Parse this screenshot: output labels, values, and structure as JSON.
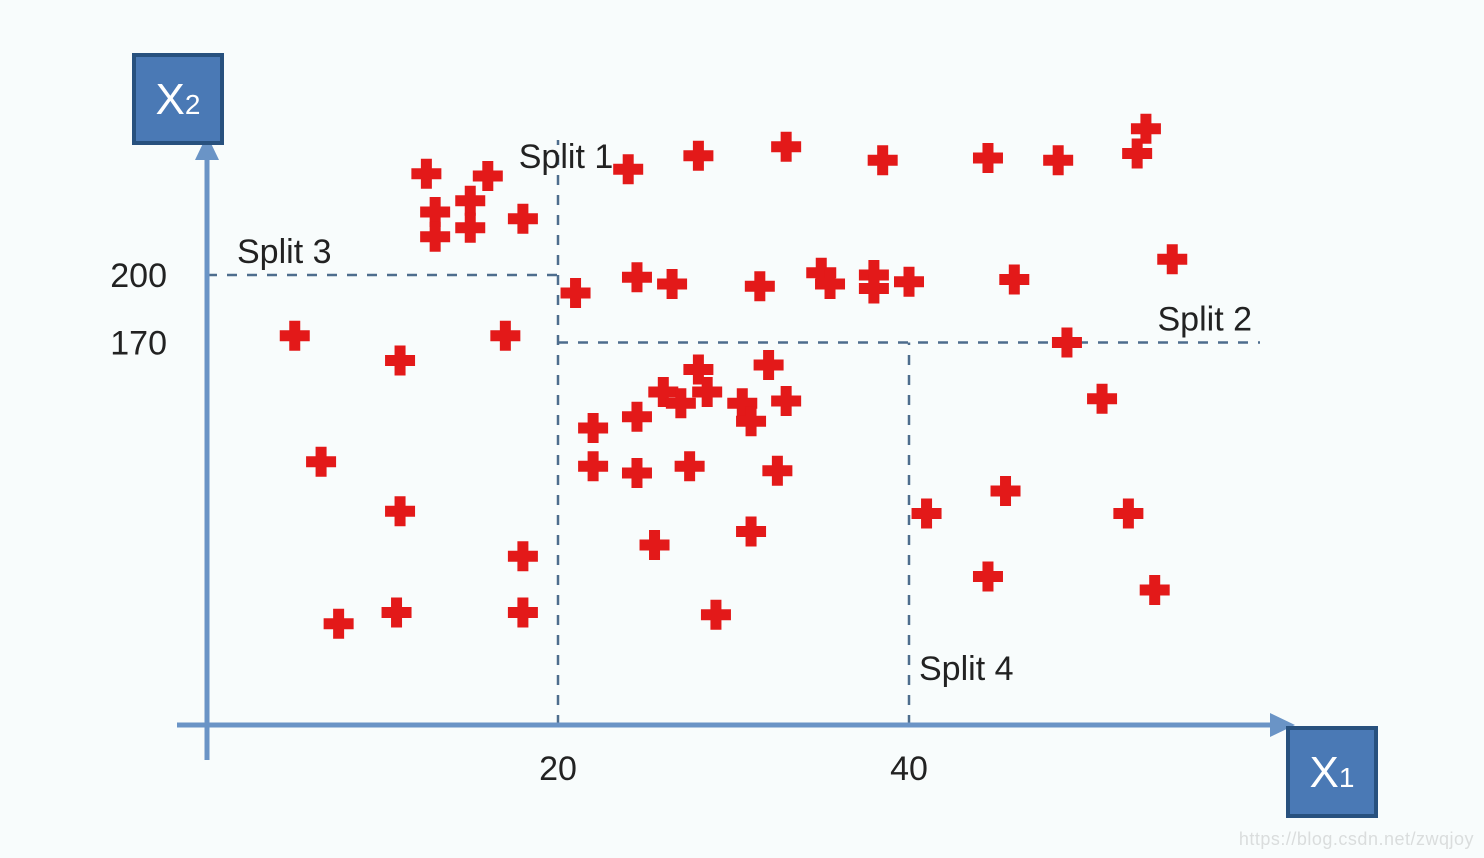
{
  "chart_data": {
    "type": "scatter",
    "xlabel": "X1",
    "ylabel": "X2",
    "x_ticks": [
      20,
      40
    ],
    "y_ticks": [
      170,
      200
    ],
    "xlim": [
      0,
      60
    ],
    "ylim": [
      0,
      260
    ],
    "splits": [
      {
        "name": "Split 1",
        "axis": "x",
        "value": 20,
        "y_from": 0,
        "y_to": 260
      },
      {
        "name": "Split 2",
        "axis": "y",
        "value": 170,
        "x_from": 20,
        "x_to": 60
      },
      {
        "name": "Split 3",
        "axis": "y",
        "value": 200,
        "x_from": 0,
        "x_to": 20
      },
      {
        "name": "Split 4",
        "axis": "x",
        "value": 40,
        "y_from": 0,
        "y_to": 170
      }
    ],
    "split_labels": {
      "split1": "Split 1",
      "split2": "Split 2",
      "split3": "Split 3",
      "split4": "Split 4"
    },
    "points": [
      [
        5,
        173
      ],
      [
        6.5,
        117
      ],
      [
        7.5,
        45
      ],
      [
        11,
        162
      ],
      [
        11,
        95
      ],
      [
        10.8,
        50
      ],
      [
        12.5,
        245
      ],
      [
        13,
        228
      ],
      [
        13,
        217
      ],
      [
        15,
        233
      ],
      [
        15,
        221
      ],
      [
        16,
        244
      ],
      [
        17,
        173
      ],
      [
        18,
        225
      ],
      [
        18,
        75
      ],
      [
        18,
        50
      ],
      [
        21,
        192
      ],
      [
        22,
        132
      ],
      [
        22,
        115
      ],
      [
        24,
        247
      ],
      [
        24.5,
        199
      ],
      [
        24.5,
        137
      ],
      [
        24.5,
        112
      ],
      [
        25.5,
        80
      ],
      [
        26,
        148
      ],
      [
        27,
        143
      ],
      [
        26.5,
        196
      ],
      [
        27.5,
        115
      ],
      [
        28,
        253
      ],
      [
        28,
        158
      ],
      [
        28.5,
        148
      ],
      [
        29,
        49
      ],
      [
        30.5,
        143
      ],
      [
        31,
        86
      ],
      [
        31,
        135
      ],
      [
        31.5,
        195
      ],
      [
        32,
        160
      ],
      [
        32.5,
        113
      ],
      [
        33,
        144
      ],
      [
        33,
        257
      ],
      [
        35,
        201
      ],
      [
        35.5,
        196
      ],
      [
        38,
        200
      ],
      [
        38,
        194
      ],
      [
        38.5,
        251
      ],
      [
        40,
        197
      ],
      [
        41,
        94
      ],
      [
        44.5,
        252
      ],
      [
        44.5,
        66
      ],
      [
        45.5,
        104
      ],
      [
        46,
        198
      ],
      [
        48.5,
        251
      ],
      [
        49,
        170
      ],
      [
        51,
        145
      ],
      [
        53.5,
        265
      ],
      [
        52.5,
        94
      ],
      [
        53,
        254
      ],
      [
        54,
        60
      ],
      [
        55,
        207
      ]
    ]
  },
  "watermark": "https://blog.csdn.net/zwqjoy"
}
